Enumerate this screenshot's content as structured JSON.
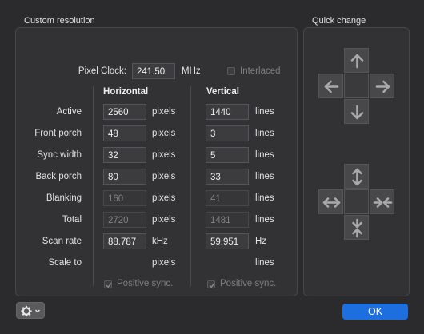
{
  "sections": {
    "custom_resolution": "Custom resolution",
    "quick_change": "Quick change"
  },
  "pixel_clock": {
    "label": "Pixel Clock:",
    "value": "241.50",
    "unit": "MHz"
  },
  "interlaced": {
    "label": "Interlaced",
    "checked": false,
    "enabled": false
  },
  "columns": {
    "horizontal": "Horizontal",
    "vertical": "Vertical"
  },
  "rows": [
    {
      "label": "Active",
      "h": "2560",
      "h_unit": "pixels",
      "v": "1440",
      "v_unit": "lines",
      "editable": true
    },
    {
      "label": "Front porch",
      "h": "48",
      "h_unit": "pixels",
      "v": "3",
      "v_unit": "lines",
      "editable": true
    },
    {
      "label": "Sync width",
      "h": "32",
      "h_unit": "pixels",
      "v": "5",
      "v_unit": "lines",
      "editable": true
    },
    {
      "label": "Back porch",
      "h": "80",
      "h_unit": "pixels",
      "v": "33",
      "v_unit": "lines",
      "editable": true
    },
    {
      "label": "Blanking",
      "h": "160",
      "h_unit": "pixels",
      "v": "41",
      "v_unit": "lines",
      "editable": false
    },
    {
      "label": "Total",
      "h": "2720",
      "h_unit": "pixels",
      "v": "1481",
      "v_unit": "lines",
      "editable": false
    },
    {
      "label": "Scan rate",
      "h": "88.787",
      "h_unit": "kHz",
      "v": "59.951",
      "v_unit": "Hz",
      "editable": true
    },
    {
      "label": "Scale to",
      "h": "",
      "h_unit": "pixels",
      "v": "",
      "v_unit": "lines",
      "editable": true
    }
  ],
  "positive_sync": {
    "label": "Positive sync.",
    "h_checked": true,
    "v_checked": true,
    "enabled": false
  },
  "quick_change_icons": {
    "up": "arrow-up-icon",
    "left": "arrow-left-icon",
    "right": "arrow-right-icon",
    "down": "arrow-down-icon",
    "v_expand": "expand-vertical-icon",
    "h_expand": "expand-horizontal-icon",
    "h_shrink": "shrink-horizontal-icon",
    "v_shrink": "shrink-vertical-icon"
  },
  "ok_button": "OK",
  "settings_menu_icon": "gear-icon",
  "colors": {
    "accent": "#1d6fe0",
    "background": "#2b2b2d"
  }
}
